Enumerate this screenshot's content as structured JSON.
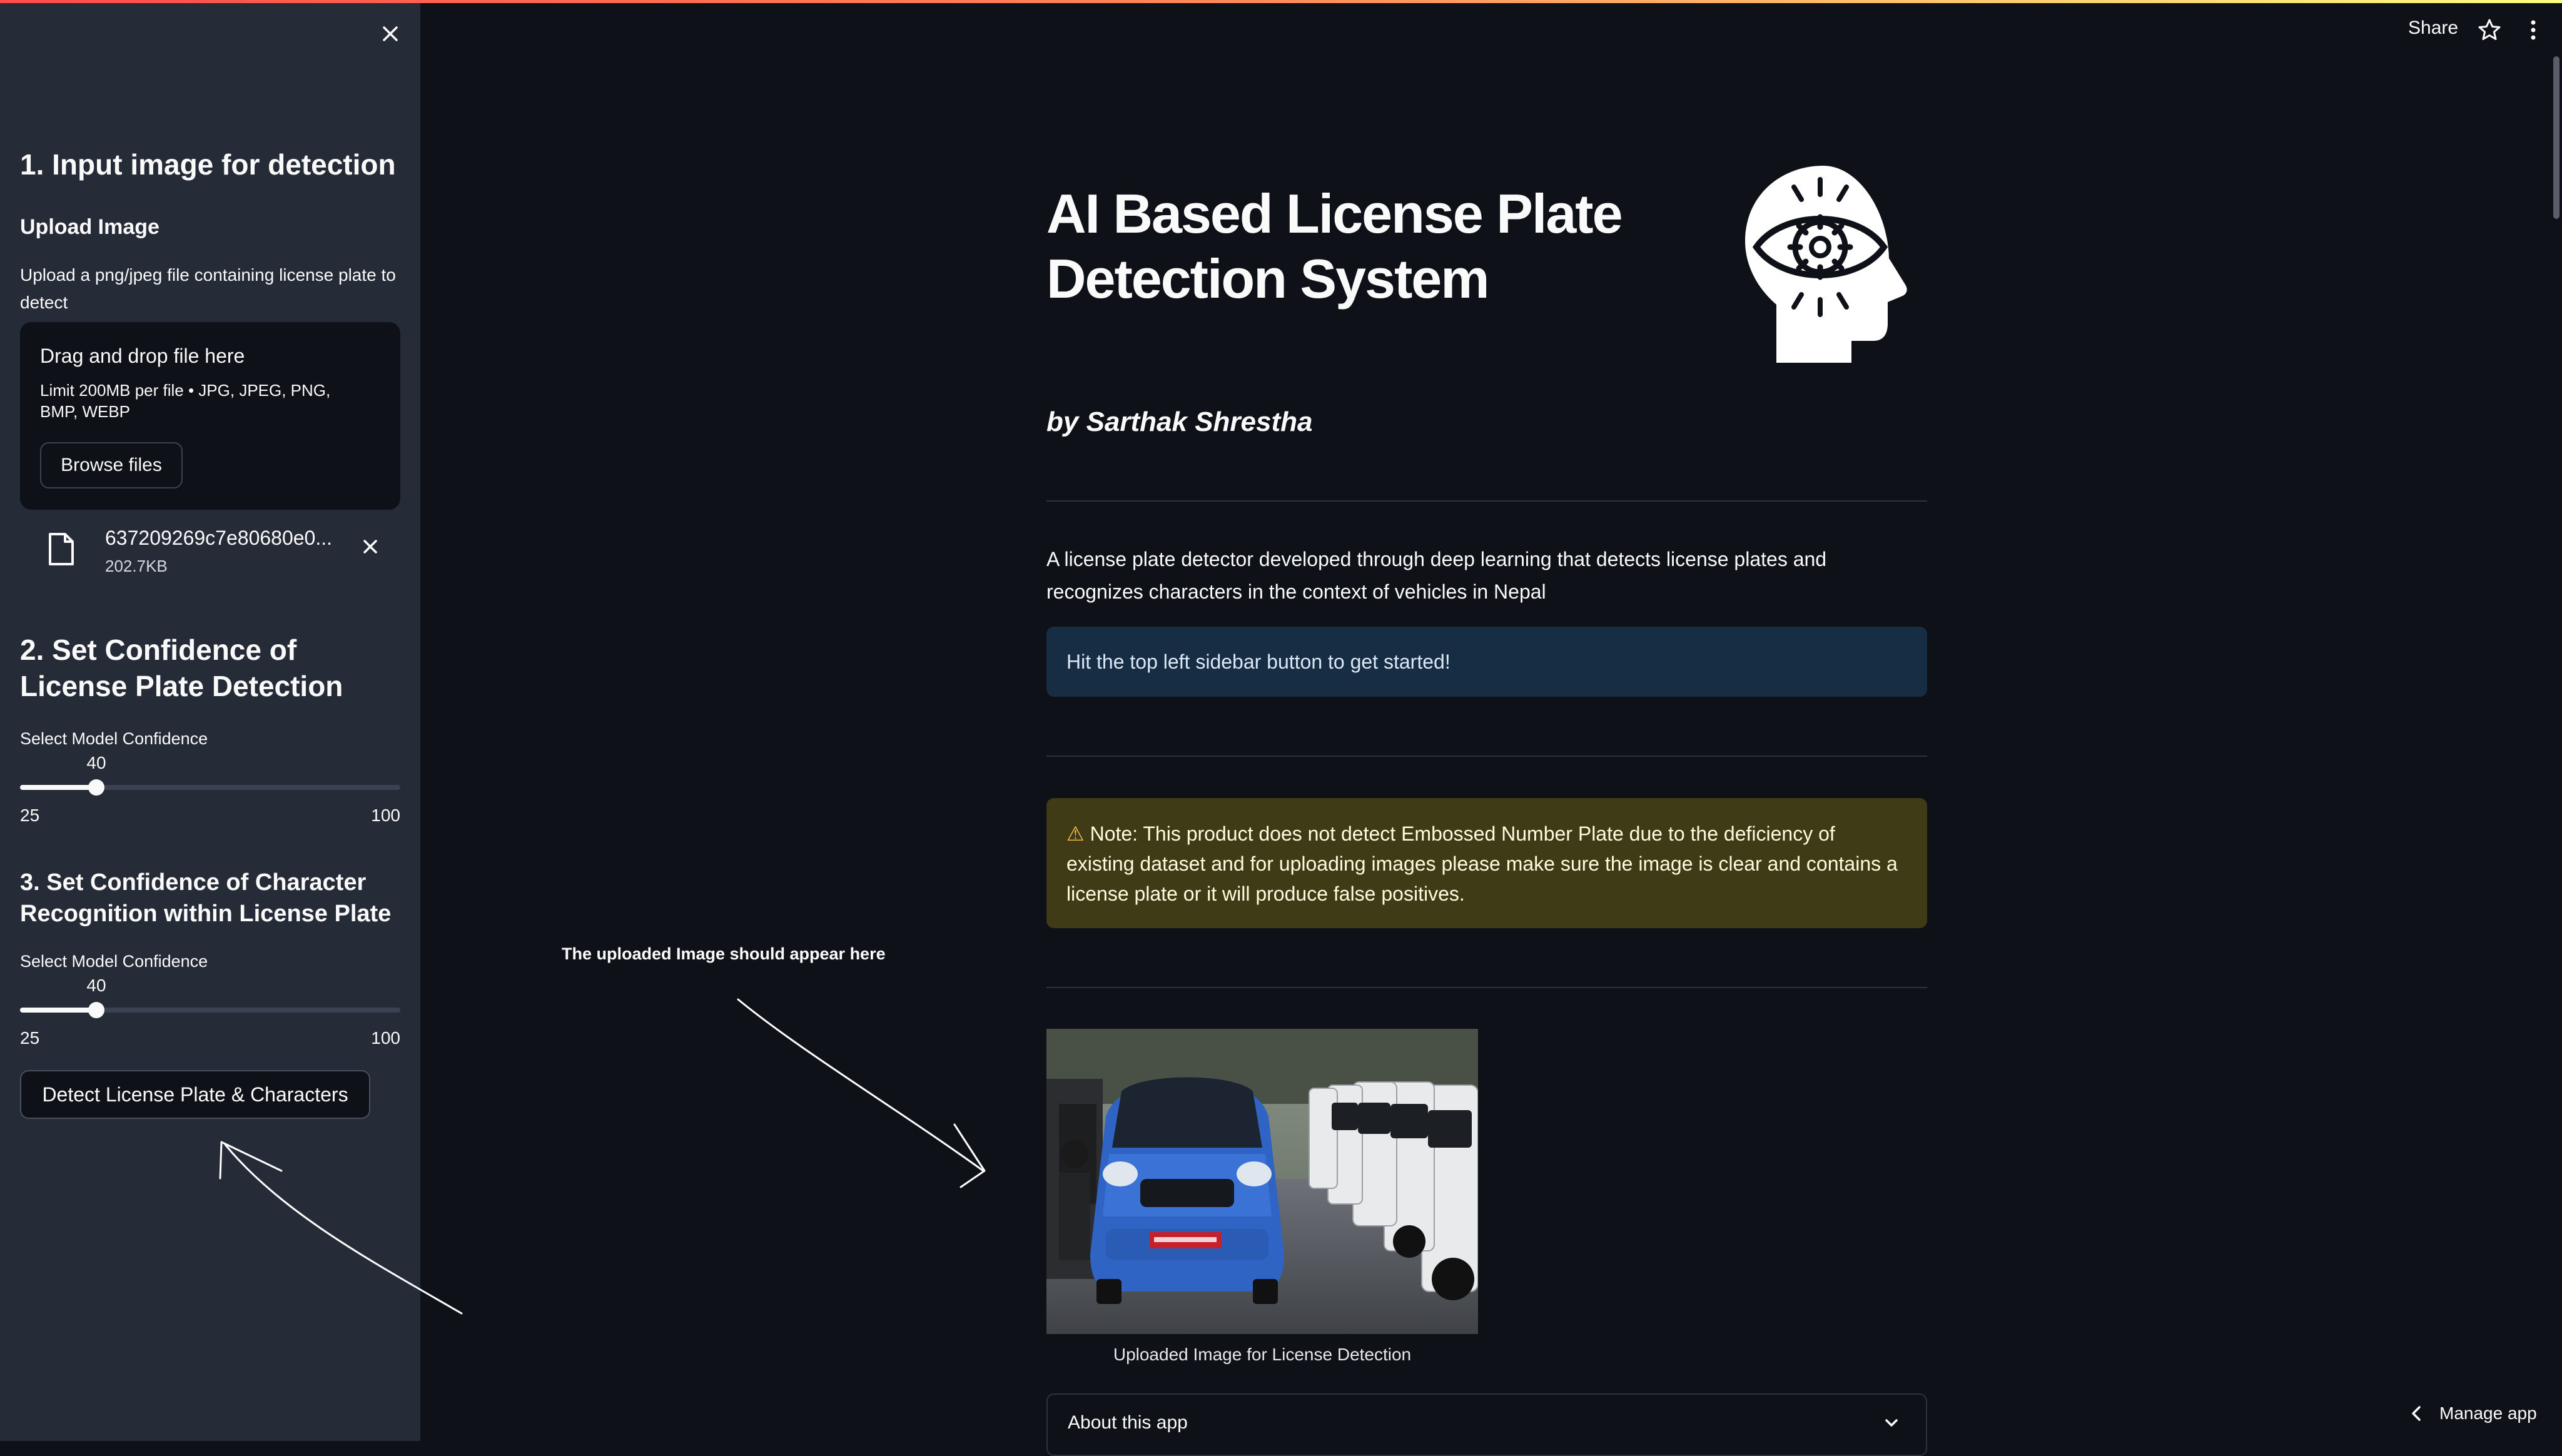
{
  "sidebar": {
    "section1_title": "1. Input image for detection",
    "upload_label": "Upload Image",
    "upload_help": "Upload a png/jpeg file containing license plate to detect",
    "dropzone": {
      "title": "Drag and drop file here",
      "limit": "Limit 200MB per file • JPG, JPEG, PNG, BMP, WEBP",
      "browse_label": "Browse files"
    },
    "file": {
      "name": "637209269c7e80680e0...",
      "size": "202.7KB"
    },
    "section2_title": "2. Set Confidence of License Plate Detection",
    "slider1": {
      "label": "Select Model Confidence",
      "value": 40,
      "min": 25,
      "max": 100
    },
    "section3_title": "3. Set Confidence of Character Recognition within License Plate",
    "slider2": {
      "label": "Select Model Confidence",
      "value": 40,
      "min": 25,
      "max": 100
    },
    "detect_label": "Detect License Plate & Characters"
  },
  "header": {
    "share_label": "Share"
  },
  "main": {
    "title": "AI Based License Plate Detection System",
    "byline": "by Sarthak Shrestha",
    "description": "A license plate detector developed through deep learning that detects license plates and recognizes characters in the context of vehicles in Nepal",
    "info": "Hit the top left sidebar button to get started!",
    "warning_icon": "⚠",
    "warning": "Note: This product does not detect Embossed Number Plate due to the deficiency of existing dataset and for uploading images please make sure the image is clear and contains a license plate or it will produce false positives.",
    "image_caption": "Uploaded Image for License Detection",
    "expander_label": "About this app",
    "annotation": "The uploaded Image should appear here"
  },
  "footer": {
    "manage_label": "Manage app"
  },
  "colors": {
    "background": "#0e1117",
    "sidebar": "#262b38",
    "info_bg": "#172d43",
    "warning_bg": "#3e3b16",
    "car_blue": "#2f63c4"
  }
}
